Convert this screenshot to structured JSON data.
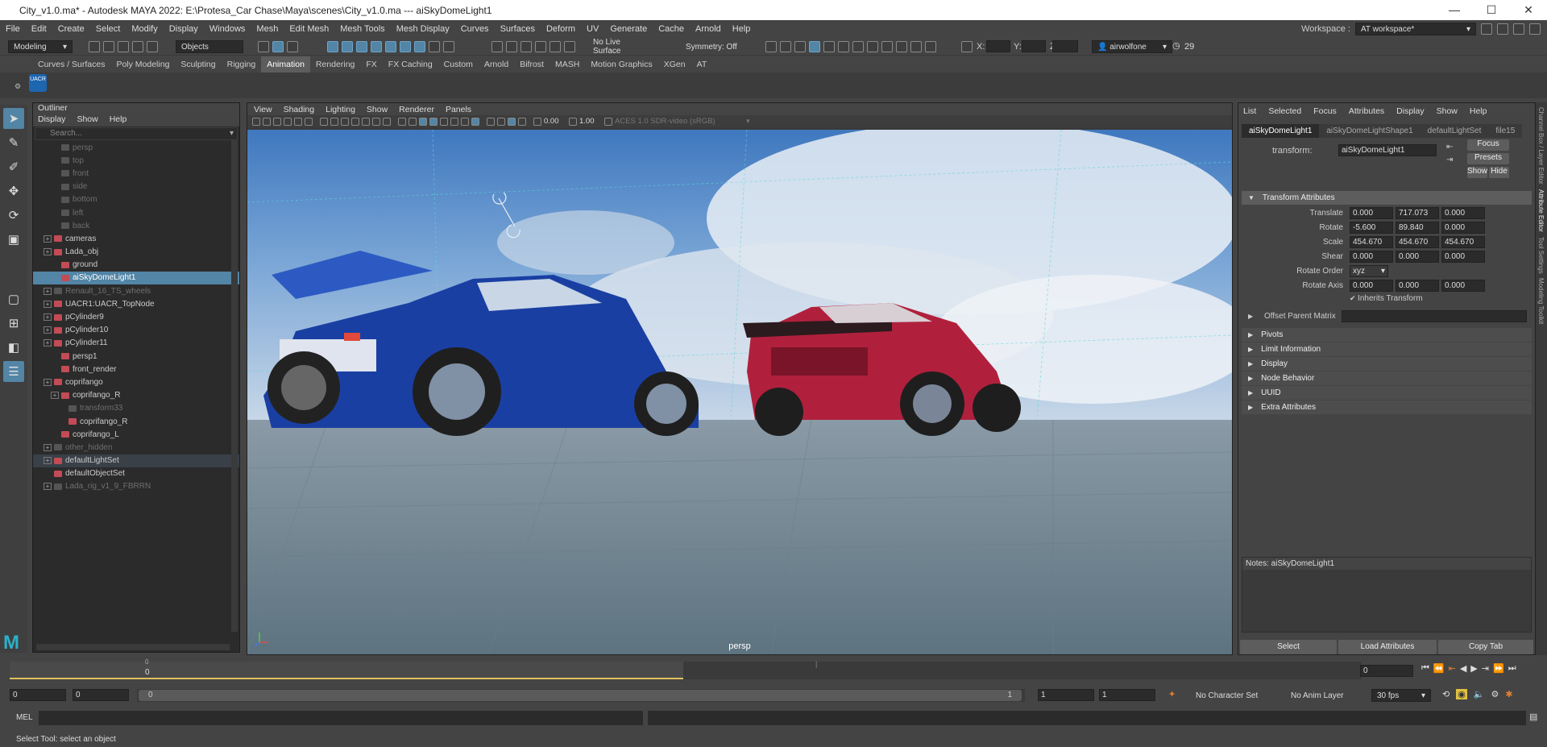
{
  "window": {
    "title": "City_v1.0.ma* - Autodesk MAYA 2022: E:\\Protesa_Car Chase\\Maya\\scenes\\City_v1.0.ma  ---  aiSkyDomeLight1",
    "minimize": "—",
    "maximize": "☐",
    "close": "✕"
  },
  "menu": [
    "File",
    "Edit",
    "Create",
    "Select",
    "Modify",
    "Display",
    "Windows",
    "Mesh",
    "Edit Mesh",
    "Mesh Tools",
    "Mesh Display",
    "Curves",
    "Surfaces",
    "Deform",
    "UV",
    "Generate",
    "Cache",
    "Arnold",
    "Help"
  ],
  "workspace": {
    "label": "Workspace :",
    "value": "AT workspace*"
  },
  "statusline": {
    "mode": "Modeling",
    "objects": "Objects",
    "live_surface": "No Live Surface",
    "symmetry": "Symmetry: Off",
    "x_label": "X:",
    "y_label": "Y:",
    "z_label": "Z:",
    "user": "airwolfone",
    "count": "29"
  },
  "shelf_tabs": [
    "Curves / Surfaces",
    "Poly Modeling",
    "Sculpting",
    "Rigging",
    "Animation",
    "Rendering",
    "FX",
    "FX Caching",
    "Custom",
    "Arnold",
    "Bifrost",
    "MASH",
    "Motion Graphics",
    "XGen",
    "AT"
  ],
  "shelf_active": "Animation",
  "shelf_item": "UACR",
  "outliner": {
    "title": "Outliner",
    "menu": [
      "Display",
      "Show",
      "Help"
    ],
    "search_placeholder": "Search...",
    "items": [
      {
        "label": "persp",
        "indent": 2,
        "dim": true
      },
      {
        "label": "top",
        "indent": 2,
        "dim": true
      },
      {
        "label": "front",
        "indent": 2,
        "dim": true
      },
      {
        "label": "side",
        "indent": 2,
        "dim": true
      },
      {
        "label": "bottom",
        "indent": 2,
        "dim": true
      },
      {
        "label": "left",
        "indent": 2,
        "dim": true
      },
      {
        "label": "back",
        "indent": 2,
        "dim": true
      },
      {
        "label": "cameras",
        "indent": 1,
        "exp": true
      },
      {
        "label": "Lada_obj",
        "indent": 1,
        "exp": true
      },
      {
        "label": "ground",
        "indent": 2
      },
      {
        "label": "aiSkyDomeLight1",
        "indent": 2,
        "sel": true
      },
      {
        "label": "Renault_16_TS_wheels",
        "indent": 1,
        "exp": true,
        "dim": true
      },
      {
        "label": "UACR1:UACR_TopNode",
        "indent": 1,
        "exp": true
      },
      {
        "label": "pCylinder9",
        "indent": 1,
        "exp": true
      },
      {
        "label": "pCylinder10",
        "indent": 1,
        "exp": true
      },
      {
        "label": "pCylinder11",
        "indent": 1,
        "exp": true
      },
      {
        "label": "persp1",
        "indent": 2
      },
      {
        "label": "front_render",
        "indent": 2
      },
      {
        "label": "coprifango",
        "indent": 1,
        "exp": true
      },
      {
        "label": "coprifango_R",
        "indent": 2,
        "exp": true
      },
      {
        "label": "transform33",
        "indent": 3,
        "dim": true
      },
      {
        "label": "coprifango_R",
        "indent": 3
      },
      {
        "label": "coprifango_L",
        "indent": 2
      },
      {
        "label": "other_hidden",
        "indent": 1,
        "exp": true,
        "dim": true
      },
      {
        "label": "defaultLightSet",
        "indent": 1,
        "exp": true,
        "sel2": true
      },
      {
        "label": "defaultObjectSet",
        "indent": 1
      },
      {
        "label": "Lada_rig_v1_9_FBRRN",
        "indent": 1,
        "exp": true,
        "dim": true
      }
    ]
  },
  "viewport": {
    "menu": [
      "View",
      "Shading",
      "Lighting",
      "Show",
      "Renderer",
      "Panels"
    ],
    "exposure": "0.00",
    "gamma": "1.00",
    "colorspace": "ACES 1.0 SDR-video (sRGB)",
    "camera_label": "persp"
  },
  "attribute_editor": {
    "menu": [
      "List",
      "Selected",
      "Focus",
      "Attributes",
      "Display",
      "Show",
      "Help"
    ],
    "tabs": [
      "aiSkyDomeLight1",
      "aiSkyDomeLightShape1",
      "defaultLightSet",
      "file15"
    ],
    "active_tab": "aiSkyDomeLight1",
    "transform_label": "transform:",
    "transform_value": "aiSkyDomeLight1",
    "btn_focus": "Focus",
    "btn_presets": "Presets",
    "btn_show": "Show",
    "btn_hide": "Hide",
    "section_transform": "Transform Attributes",
    "translate": {
      "label": "Translate",
      "values": [
        "0.000",
        "717.073",
        "0.000"
      ]
    },
    "rotate": {
      "label": "Rotate",
      "values": [
        "-5.600",
        "89.840",
        "0.000"
      ]
    },
    "scale": {
      "label": "Scale",
      "values": [
        "454.670",
        "454.670",
        "454.670"
      ]
    },
    "shear": {
      "label": "Shear",
      "values": [
        "0.000",
        "0.000",
        "0.000"
      ]
    },
    "rotate_order": {
      "label": "Rotate Order",
      "value": "xyz"
    },
    "rotate_axis": {
      "label": "Rotate Axis",
      "values": [
        "0.000",
        "0.000",
        "0.000"
      ]
    },
    "inherits": "Inherits Transform",
    "offset_parent": "Offset Parent Matrix",
    "collapsed_sections": [
      "Pivots",
      "Limit Information",
      "Display",
      "Node Behavior",
      "UUID",
      "Extra Attributes"
    ],
    "notes": "Notes:  aiSkyDomeLight1",
    "btn_select": "Select",
    "btn_load": "Load Attributes",
    "btn_copy": "Copy Tab"
  },
  "right_strip": [
    "Channel Box / Layer Editor",
    "Attribute Editor",
    "Tool Settings",
    "Modeling Toolkit"
  ],
  "timeline": {
    "top_frame": "0",
    "current_frame": "0",
    "mid_tick": "|",
    "current_field": "0"
  },
  "range": {
    "start": "0",
    "start2": "0",
    "slider_start": "0",
    "slider_end": "1",
    "end": "1",
    "end2": "1",
    "character_set": "No Character Set",
    "anim_layer": "No Anim Layer",
    "fps": "30 fps"
  },
  "cmdline": {
    "label": "MEL"
  },
  "help_line": "Select Tool: select an object"
}
